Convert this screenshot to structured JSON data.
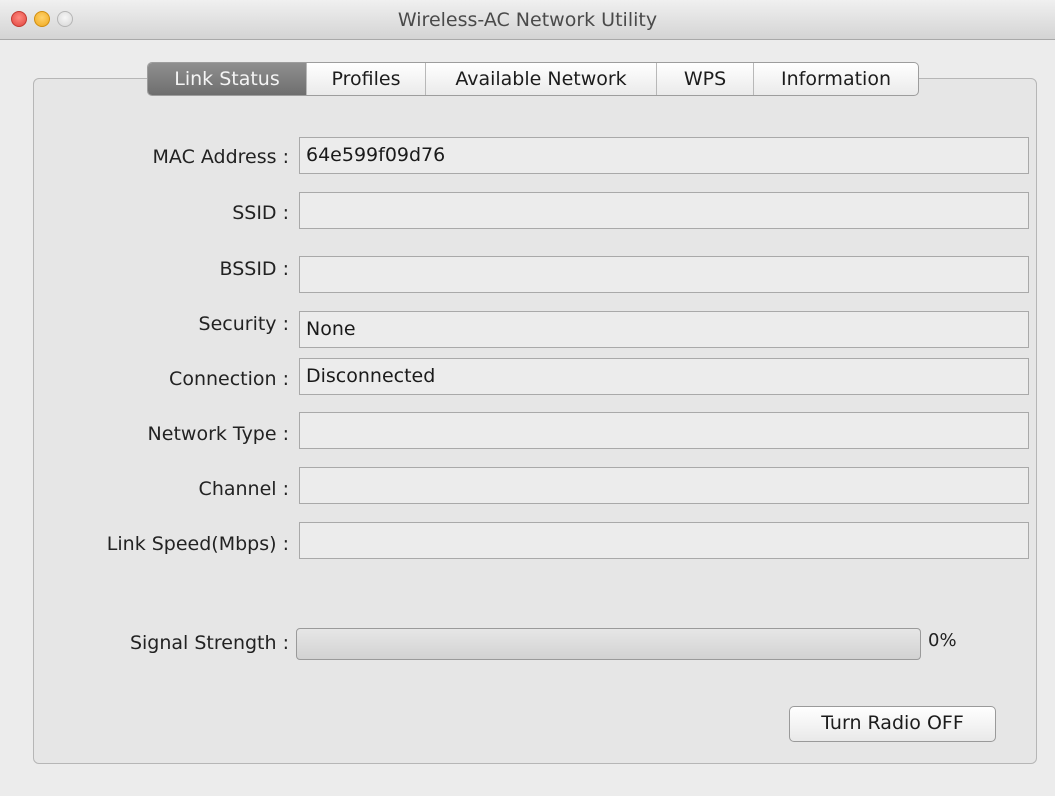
{
  "window": {
    "title": "Wireless-AC Network Utility"
  },
  "tabs": [
    {
      "label": "Link Status",
      "active": true
    },
    {
      "label": "Profiles",
      "active": false
    },
    {
      "label": "Available Network",
      "active": false
    },
    {
      "label": "WPS",
      "active": false
    },
    {
      "label": "Information",
      "active": false
    }
  ],
  "fields": {
    "mac_address": {
      "label": "MAC Address :",
      "value": "64e599f09d76"
    },
    "ssid": {
      "label": "SSID :",
      "value": ""
    },
    "bssid": {
      "label": "BSSID :",
      "value": ""
    },
    "security": {
      "label": "Security :",
      "value": "None"
    },
    "connection": {
      "label": "Connection :",
      "value": "Disconnected"
    },
    "network_type": {
      "label": "Network Type :",
      "value": ""
    },
    "channel": {
      "label": "Channel :",
      "value": ""
    },
    "link_speed": {
      "label": "Link Speed(Mbps) :",
      "value": ""
    }
  },
  "signal": {
    "label": "Signal Strength :",
    "percent": 0,
    "percent_text": "0%"
  },
  "actions": {
    "radio_button_label": "Turn Radio OFF"
  },
  "colors": {
    "active_tab": "#7d7d7d",
    "close_button": "#e0443e",
    "minimize_button": "#f0a81c"
  },
  "icons": {
    "close": "close-icon",
    "minimize": "minimize-icon",
    "zoom": "zoom-icon"
  }
}
